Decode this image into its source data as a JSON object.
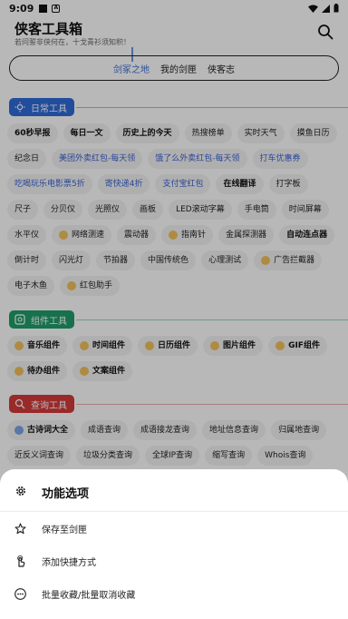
{
  "status_bar": {
    "time": "9:09"
  },
  "header": {
    "title": "侠客工具箱",
    "subtitle": "若问誓非侠何在，十戈青衫须知积！"
  },
  "tabs": [
    {
      "label": "剑冢之地",
      "active": true
    },
    {
      "label": "我的剑匣",
      "active": false
    },
    {
      "label": "侠客志",
      "active": false
    }
  ],
  "sections": {
    "daily": {
      "title": "日常工具",
      "rows": [
        [
          "60秒早报",
          "每日一文",
          "历史上的今天",
          "热搜榜单",
          "实时天气",
          "摸鱼日历"
        ],
        [
          "纪念日",
          "美团外卖红包-每天领",
          "饿了么外卖红包-每天领",
          "打车优惠券"
        ],
        [
          "吃喝玩乐电影票5折",
          "寄快递4折",
          "支付宝红包",
          "在线翻译",
          "打字板"
        ],
        [
          "尺子",
          "分贝仪",
          "光照仪",
          "画板",
          "LED滚动字幕",
          "手电筒",
          "时间屏幕"
        ],
        [
          "水平仪",
          "网络测速",
          "震动器",
          "指南针",
          "金属探测器",
          "自动连点器"
        ],
        [
          "倒计时",
          "闪光灯",
          "节拍器",
          "中国传统色",
          "心理测试",
          "广告拦截器"
        ],
        [
          "电子木鱼",
          "红包助手"
        ]
      ]
    },
    "widget": {
      "title": "组件工具",
      "rows": [
        [
          "音乐组件",
          "时间组件",
          "日历组件",
          "图片组件",
          "GIF组件"
        ],
        [
          "待办组件",
          "文案组件"
        ]
      ]
    },
    "query": {
      "title": "查询工具",
      "rows": [
        [
          "古诗词大全",
          "成语查询",
          "成语接龙查询",
          "地址信息查询",
          "归属地查询"
        ],
        [
          "近反义词查询",
          "垃圾分类查询",
          "全球IP查询",
          "缩写查询",
          "Whois查询"
        ]
      ]
    }
  },
  "sheet": {
    "title": "功能选项",
    "options": [
      {
        "label": "保存至剑匣",
        "icon": "star-icon"
      },
      {
        "label": "添加快捷方式",
        "icon": "touch-icon"
      },
      {
        "label": "批量收藏/批量取消收藏",
        "icon": "more-icon"
      }
    ]
  },
  "colors": {
    "daily": "#2f6bd8",
    "widget": "#1f9d6a",
    "query": "#d43b3b",
    "active_tab": "#3b6fd8"
  }
}
